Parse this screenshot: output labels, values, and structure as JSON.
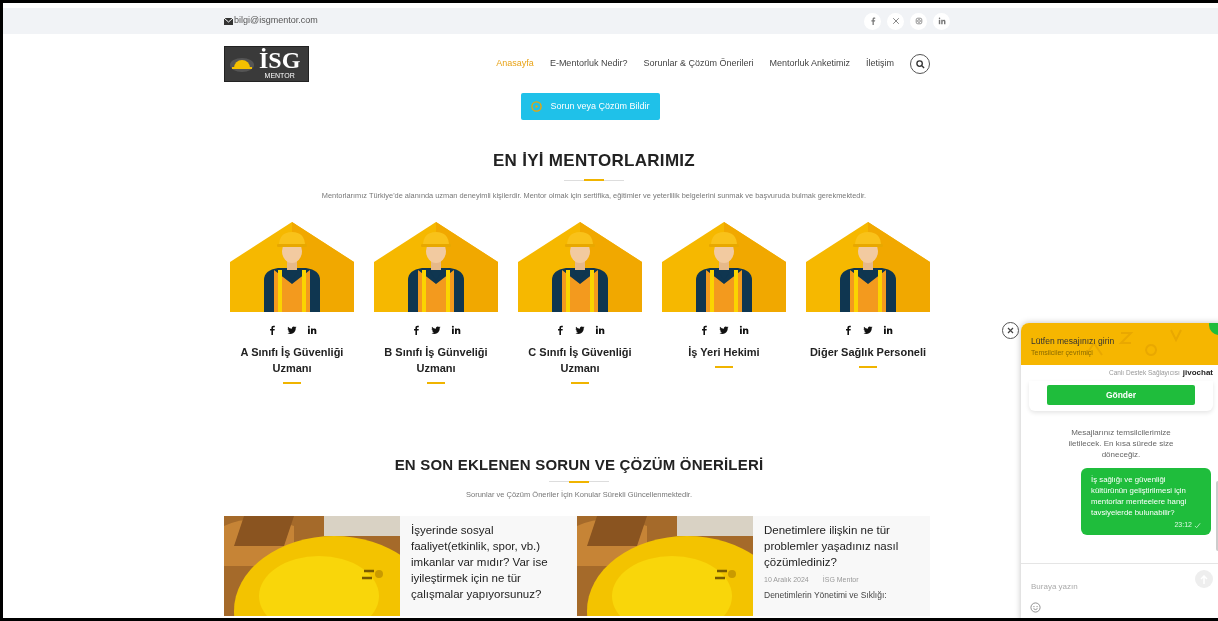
{
  "top_bar": {
    "email": "bilgi@isgmentor.com",
    "social": [
      {
        "kind": "facebook"
      },
      {
        "kind": "x"
      },
      {
        "kind": "instagram"
      },
      {
        "kind": "linkedin"
      }
    ]
  },
  "logo": {
    "text": "İSG",
    "subtext": "MENTOR"
  },
  "nav": [
    {
      "label": "Anasayfa",
      "selected": true
    },
    {
      "label": "E-Mentorluk Nedir?",
      "selected": false
    },
    {
      "label": "Sorunlar & Çözüm Önerileri",
      "selected": false
    },
    {
      "label": "Mentorluk Anketimiz",
      "selected": false
    },
    {
      "label": "İletişim",
      "selected": false
    }
  ],
  "cta_button": "Sorun veya Çözüm Bildir",
  "mentors_section": {
    "title": "EN İYİ MENTORLARIMIZ",
    "subtitle": "Mentorlarımız Türkiye'de alanında uzman deneyimli kişilerdir. Mentor olmak için sertifika, eğitimler ve yeterlilik belgelerini sunmak ve başvuruda bulmak gerekmektedir.",
    "mentors": [
      {
        "name": "A Sınıfı İş Güvenliği Uzmanı"
      },
      {
        "name": "B Sınıfı İş Günveliği Uzmanı"
      },
      {
        "name": "C Sınıfı İş Güvenliği Uzmanı"
      },
      {
        "name": "İş Yeri Hekimi"
      },
      {
        "name": "Diğer Sağlık Personeli"
      }
    ]
  },
  "posts_section": {
    "title": "EN SON EKLENEN SORUN VE ÇÖZÜM ÖNERİLERİ",
    "subtitle": "Sorunlar ve Çözüm Öneriler İçin Konular Sürekli Güncellenmektedir.",
    "posts": [
      {
        "title": "İşyerinde sosyal faaliyet(etkinlik, spor, vb.) imkanlar var mıdır? Var ise iyileştirmek için ne tür çalışmalar yapıyorsunuz?"
      },
      {
        "title": "Denetimlere ilişkin ne tür problemler yaşadınız nasıl çözümlediniz?",
        "date": "10 Aralık 2024",
        "author": "İSG Mentor",
        "excerpt": "Denetimlerin Yönetimi ve Sıklığı:"
      }
    ]
  },
  "chat": {
    "title": "Lütfen mesajınızı girin",
    "status": "Temsilciler çevrimiçi",
    "provider_label": "Canlı Destek Sağlayıcısı",
    "provider": "jivochat",
    "send_button": "Gönder",
    "info": "Mesajlarınız temsilcilerimize iletilecek. En kısa sürede size döneceğiz.",
    "messages": [
      {
        "text": "İş sağlığı ve güvenliği kültürünün geliştirilmesi için mentorlar menteelere hangi tavsiyelerde bulunabilir?",
        "time": "23:12",
        "read": true
      }
    ],
    "input": {
      "placeholder": "Buraya yazın"
    }
  }
}
